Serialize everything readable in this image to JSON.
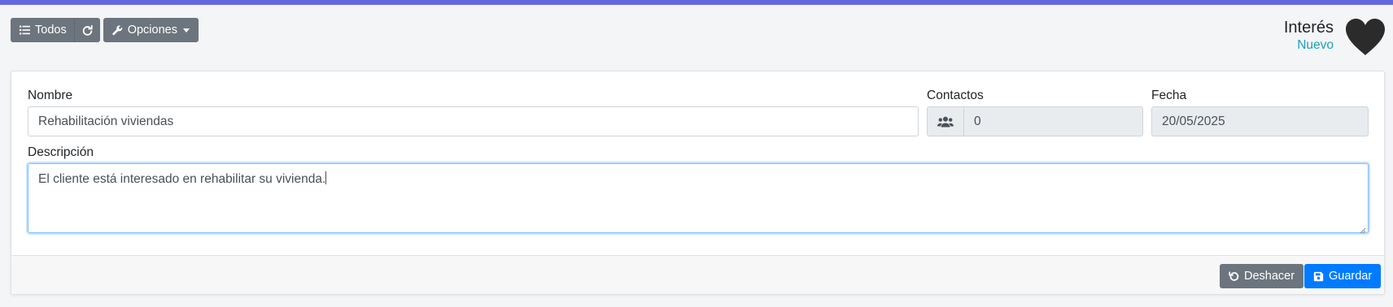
{
  "toolbar": {
    "all_label": "Todos",
    "options_label": "Opciones"
  },
  "header": {
    "title": "Interés",
    "status": "Nuevo"
  },
  "form": {
    "name": {
      "label": "Nombre",
      "value": "Rehabilitación viviendas"
    },
    "contacts": {
      "label": "Contactos",
      "value": "0"
    },
    "date": {
      "label": "Fecha",
      "value": "20/05/2025"
    },
    "description": {
      "label": "Descripción",
      "value": "El cliente está interesado en rehabilitar su vivienda."
    }
  },
  "footer": {
    "undo_label": "Deshacer",
    "save_label": "Guardar"
  },
  "colors": {
    "accent": "#6168e0",
    "status": "#17a2b8",
    "secondary_button": "#6c757d",
    "primary_button": "#007bff"
  },
  "icons": [
    "list-icon",
    "refresh-icon",
    "wrench-icon",
    "caret-down-icon",
    "heart-icon",
    "users-icon",
    "undo-icon",
    "save-icon"
  ]
}
